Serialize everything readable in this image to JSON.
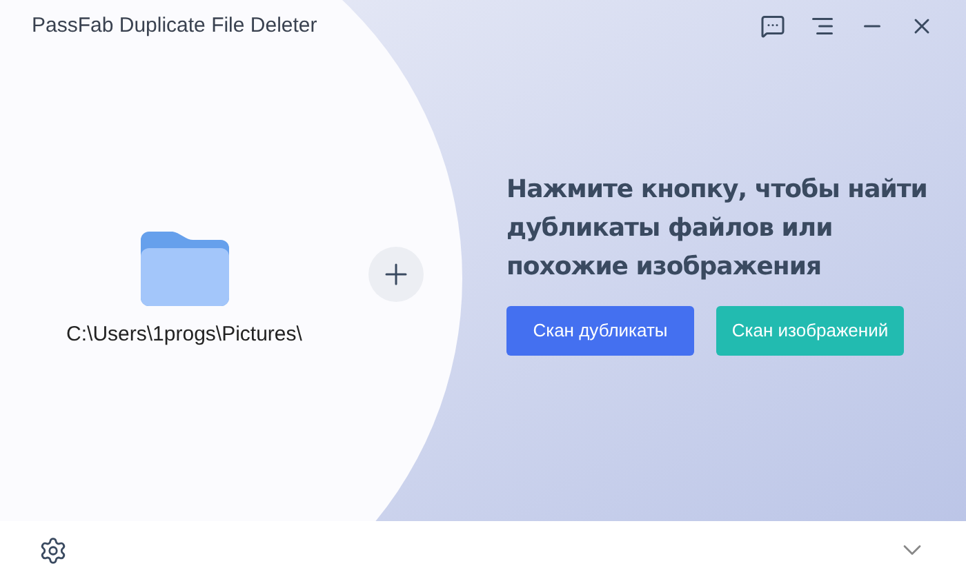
{
  "window": {
    "title": "PassFab Duplicate File Deleter"
  },
  "folder": {
    "path": "C:\\Users\\1progs\\Pictures\\"
  },
  "prompt": {
    "text": "Нажмите кнопку, чтобы найти дубликаты файлов или похожие изображения"
  },
  "buttons": [
    {
      "label": "Скан дубликаты",
      "kind": "primary"
    },
    {
      "label": "Скан изображений",
      "kind": "secondary"
    }
  ]
}
